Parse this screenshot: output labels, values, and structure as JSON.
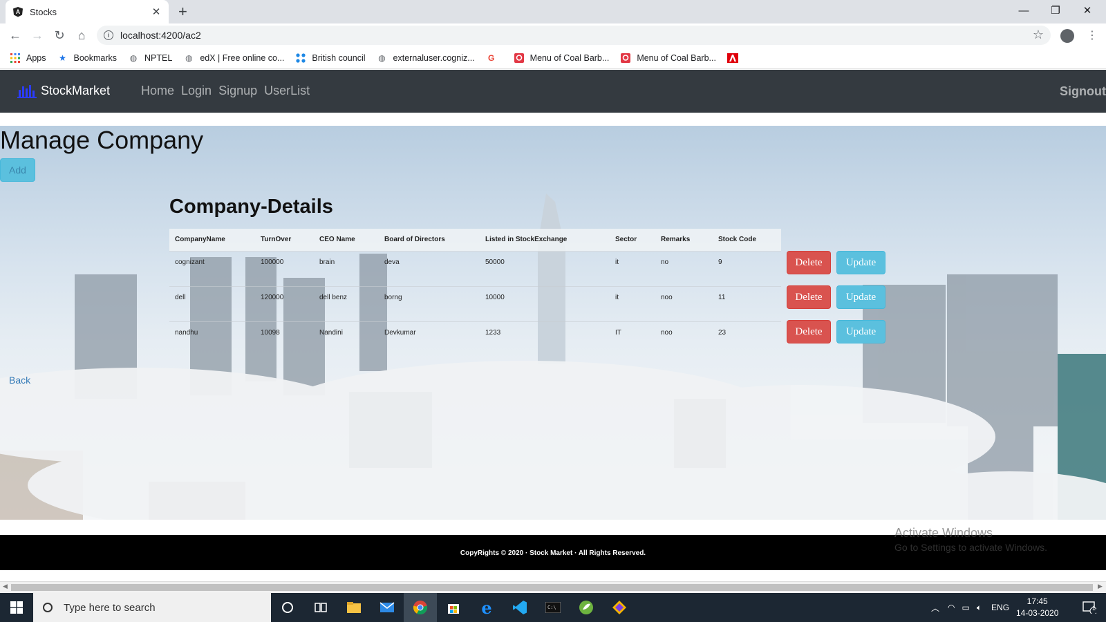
{
  "browser": {
    "tab_title": "Stocks",
    "tab_close": "✕",
    "new_tab": "+",
    "url": "localhost:4200/ac2",
    "window_controls": {
      "minimize": "—",
      "restore": "❐",
      "close": "✕"
    },
    "bookmarks": [
      {
        "label": "Apps",
        "icon": "apps-grid-icon"
      },
      {
        "label": "Bookmarks",
        "icon": "star-icon"
      },
      {
        "label": "NPTEL",
        "icon": "globe-icon"
      },
      {
        "label": "edX | Free online co...",
        "icon": "globe-icon"
      },
      {
        "label": "British council",
        "icon": "british-council-icon"
      },
      {
        "label": "externaluser.cogniz...",
        "icon": "globe-icon"
      },
      {
        "label": "",
        "icon": "google-icon"
      },
      {
        "label": "Menu of Coal Barb...",
        "icon": "zomato-icon"
      },
      {
        "label": "Menu of Coal Barb...",
        "icon": "zomato-icon"
      },
      {
        "label": "",
        "icon": "adobe-icon"
      }
    ]
  },
  "navbar": {
    "brand": "StockMarket",
    "links": [
      "Home",
      "Login",
      "Signup",
      "UserList"
    ],
    "signout": "Signout"
  },
  "main": {
    "title": "Manage Company",
    "add_label": "Add",
    "details_title": "Company-Details",
    "columns": [
      "CompanyName",
      "TurnOver",
      "CEO Name",
      "Board of Directors",
      "Listed in StockExchange",
      "Sector",
      "Remarks",
      "Stock Code"
    ],
    "rows": [
      [
        "cognizant",
        "100000",
        "brain",
        "deva",
        "50000",
        "it",
        "no",
        "9"
      ],
      [
        "dell",
        "120000",
        "dell benz",
        "borng",
        "10000",
        "it",
        "noo",
        "11"
      ],
      [
        "nandhu",
        "10098",
        "Nandini",
        "Devkumar",
        "1233",
        "IT",
        "noo",
        "23"
      ]
    ],
    "delete_label": "Delete",
    "update_label": "Update",
    "back_label": "Back"
  },
  "footer": {
    "text": "CopyRights © 2020 · Stock Market · All Rights Reserved."
  },
  "watermark": {
    "line1": "Activate Windows",
    "line2": "Go to Settings to activate Windows."
  },
  "taskbar": {
    "search_placeholder": "Type here to search",
    "language": "ENG",
    "time": "17:45",
    "date": "14-03-2020",
    "notification_count": "1"
  }
}
